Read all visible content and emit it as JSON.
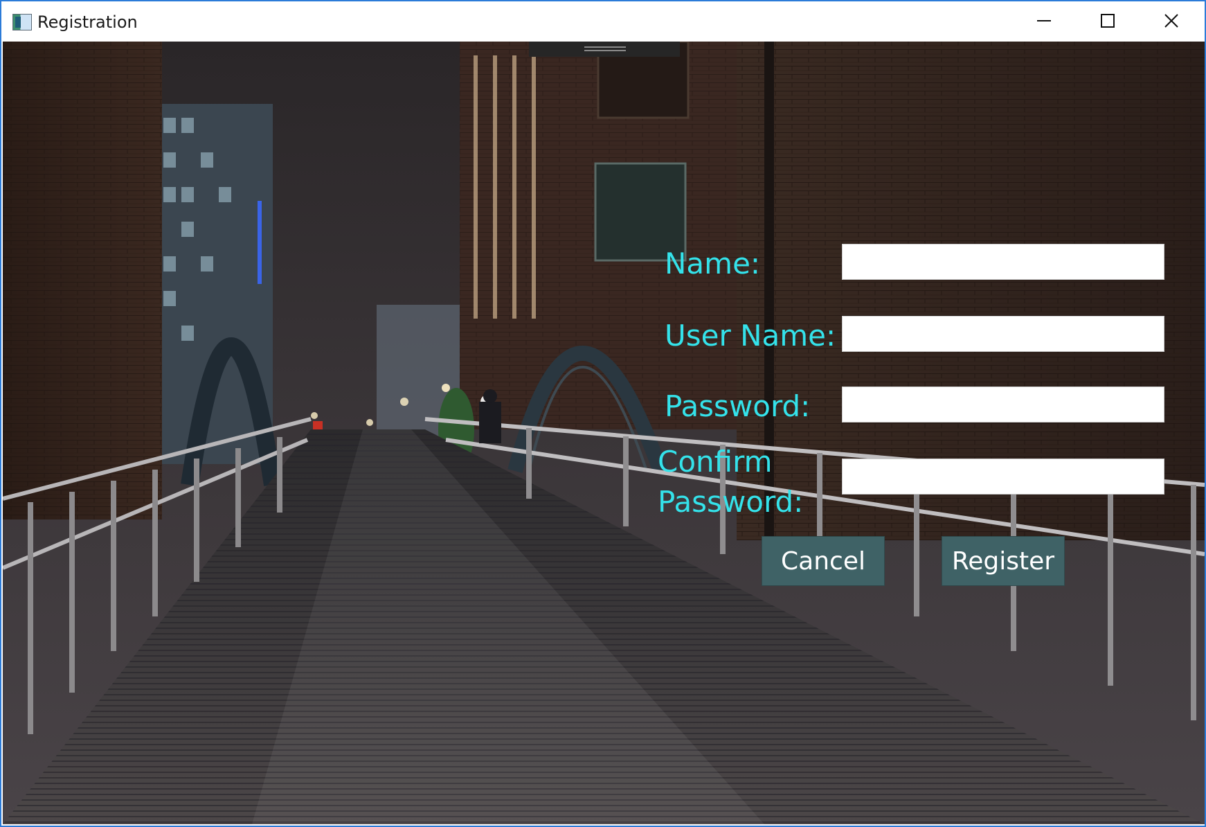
{
  "window": {
    "title": "Registration",
    "icon": "app-window-icon",
    "controls": {
      "minimize_icon": "minimize-icon",
      "maximize_icon": "maximize-icon",
      "close_icon": "close-icon"
    }
  },
  "form": {
    "name_label": "Name:",
    "name_value": "",
    "username_label": "User Name:",
    "username_value": "",
    "password_label": "Password:",
    "password_value": "",
    "confirm_password_label": "Confirm Password:",
    "confirm_password_value": ""
  },
  "buttons": {
    "cancel_label": "Cancel",
    "register_label": "Register"
  },
  "colors": {
    "label_color": "#34e2ea",
    "button_bg": "#3f6266",
    "button_text": "#ffffff",
    "window_border": "#2b7bd8"
  }
}
